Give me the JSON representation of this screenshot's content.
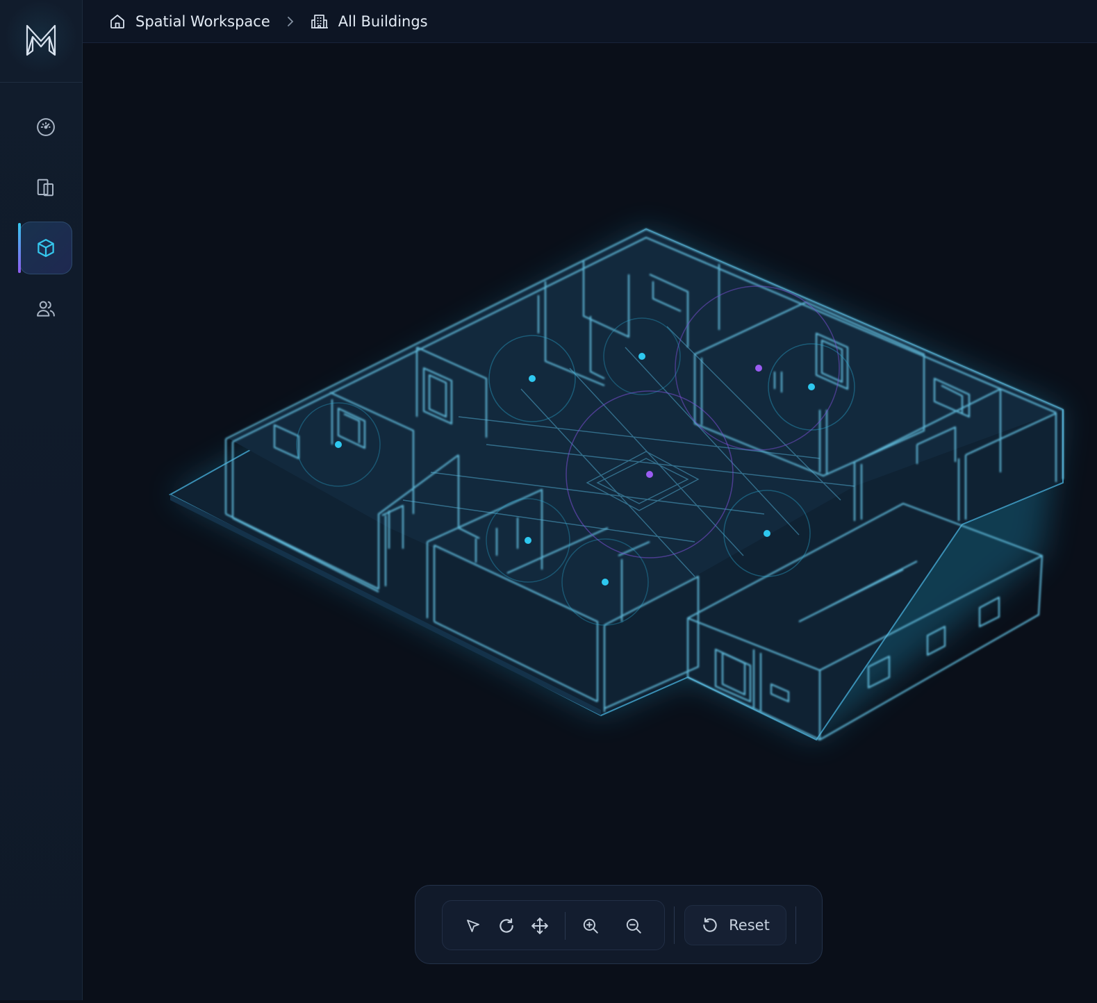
{
  "app": {
    "logo_icon": "m-logo-icon"
  },
  "breadcrumb": [
    {
      "label": "Spatial Workspace",
      "icon": "home-icon"
    },
    {
      "label": "All Buildings",
      "icon": "building-icon"
    }
  ],
  "sidebar": {
    "items": [
      {
        "name": "dashboard",
        "icon": "gauge-icon",
        "active": false
      },
      {
        "name": "devices",
        "icon": "devices-icon",
        "active": false
      },
      {
        "name": "spatial-3d",
        "icon": "cube-icon",
        "active": true
      },
      {
        "name": "users",
        "icon": "users-icon",
        "active": false
      }
    ]
  },
  "toolbar": {
    "tools": [
      {
        "name": "select",
        "icon": "cursor-icon"
      },
      {
        "name": "rotate",
        "icon": "rotate-icon"
      },
      {
        "name": "pan",
        "icon": "move-icon"
      },
      {
        "name": "zoom-in",
        "icon": "zoom-in-icon"
      },
      {
        "name": "zoom-out",
        "icon": "zoom-out-icon"
      }
    ],
    "reset_label": "Reset",
    "reset_icon": "reset-icon"
  },
  "colors": {
    "accent_cyan": "#35c7ee",
    "accent_purple": "#8f5cf0",
    "background": "#0a0f19",
    "wireframe": "#5fb8d8"
  }
}
